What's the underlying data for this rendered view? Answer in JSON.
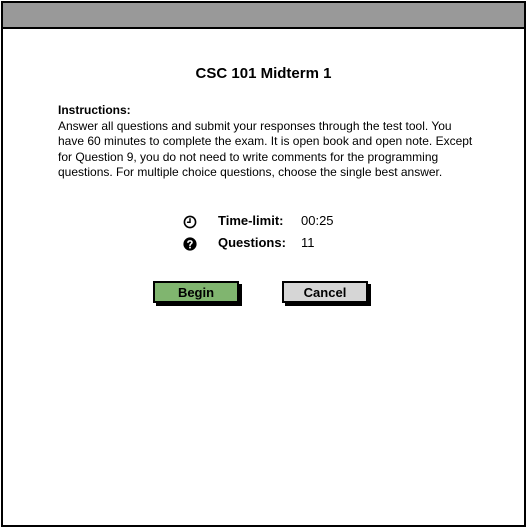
{
  "exam": {
    "title": "CSC 101  Midterm 1",
    "instructions_heading": "Instructions:",
    "instructions_text": "Answer all questions and submit your responses through the test tool. You have 60 minutes to complete the exam. It is open book and open note. Except for Question 9, you do not need to write comments for the programming questions. For multiple choice questions, choose the single best answer."
  },
  "info": {
    "time_limit_label": "Time-limit:",
    "time_limit_value": "00:25",
    "time_icon": "clock-icon",
    "questions_label": "Questions:",
    "questions_value": "11",
    "questions_icon": "question-circle-icon"
  },
  "actions": {
    "begin_label": "Begin",
    "cancel_label": "Cancel"
  },
  "colors": {
    "titlebar": "#999999",
    "begin_button": "#80b56f",
    "cancel_button": "#d6d6d6"
  }
}
